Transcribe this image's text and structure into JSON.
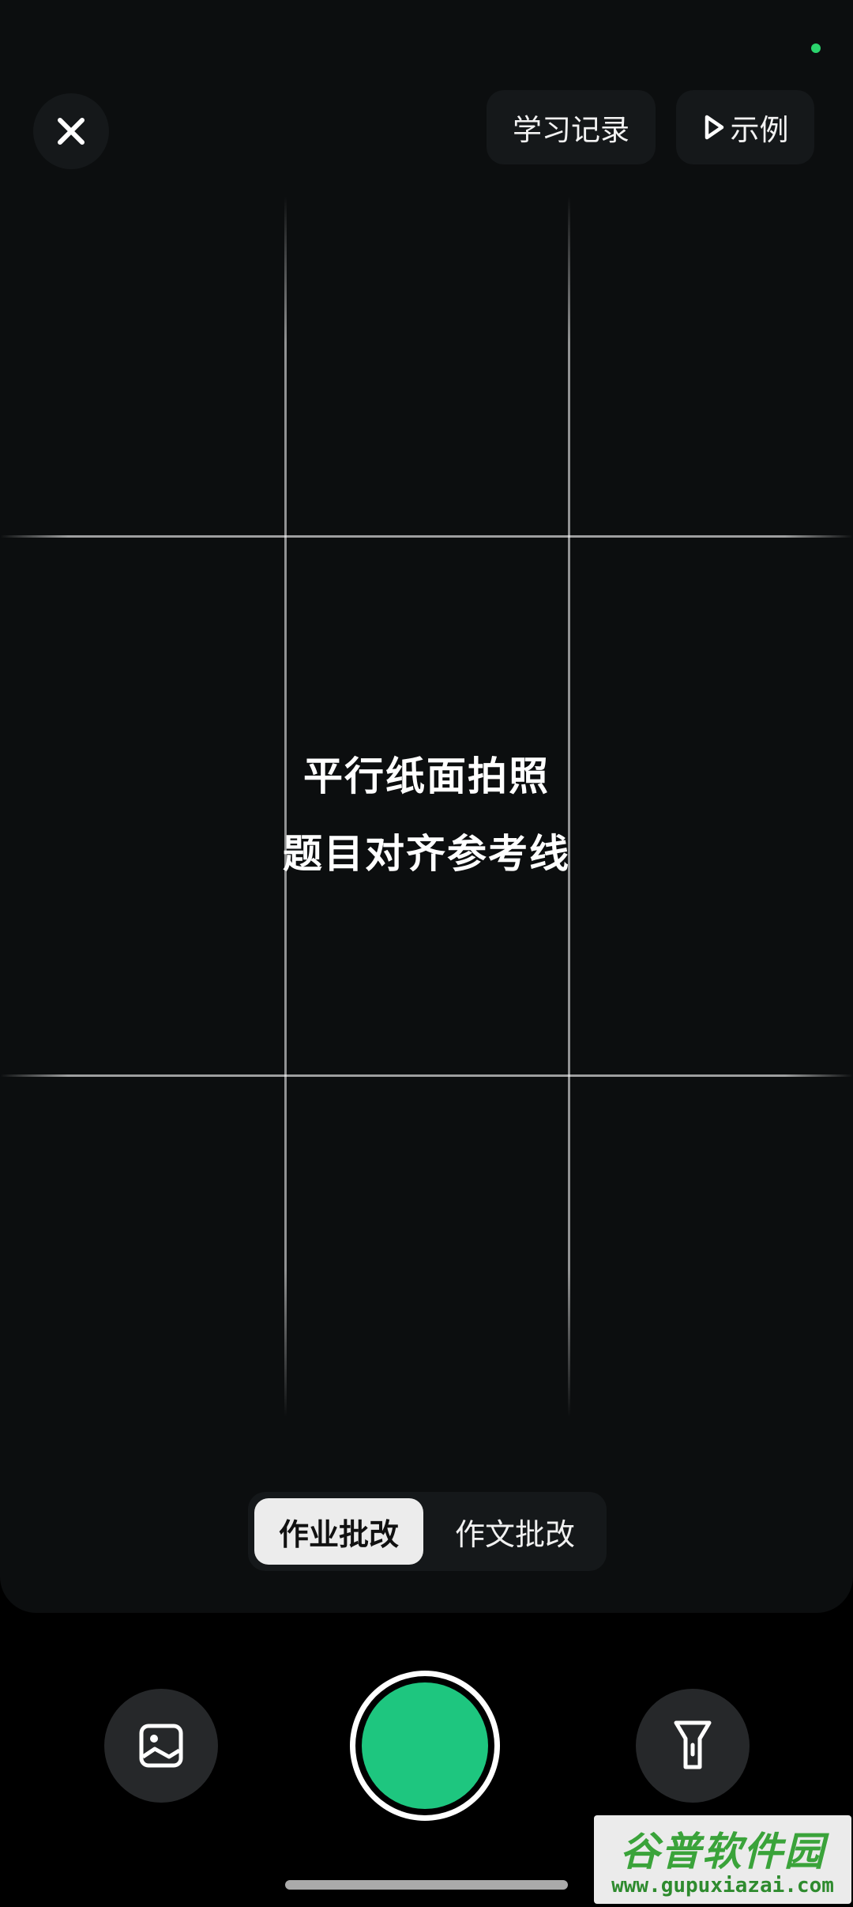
{
  "header": {
    "close_icon": "close-icon",
    "history_label": "学习记录",
    "example_label": "示例",
    "example_icon": "play-icon",
    "status_dot_color": "#2bd46d"
  },
  "hint": {
    "line1": "平行纸面拍照",
    "line2": "题目对齐参考线"
  },
  "modes": {
    "active": "作业批改",
    "inactive": "作文批改"
  },
  "controls": {
    "gallery_icon": "image-icon",
    "shutter_color": "#1ec67f",
    "flash_icon": "flashlight-icon"
  },
  "watermark": {
    "title": "谷普软件园",
    "url": "www.gupuxiazai.com"
  }
}
